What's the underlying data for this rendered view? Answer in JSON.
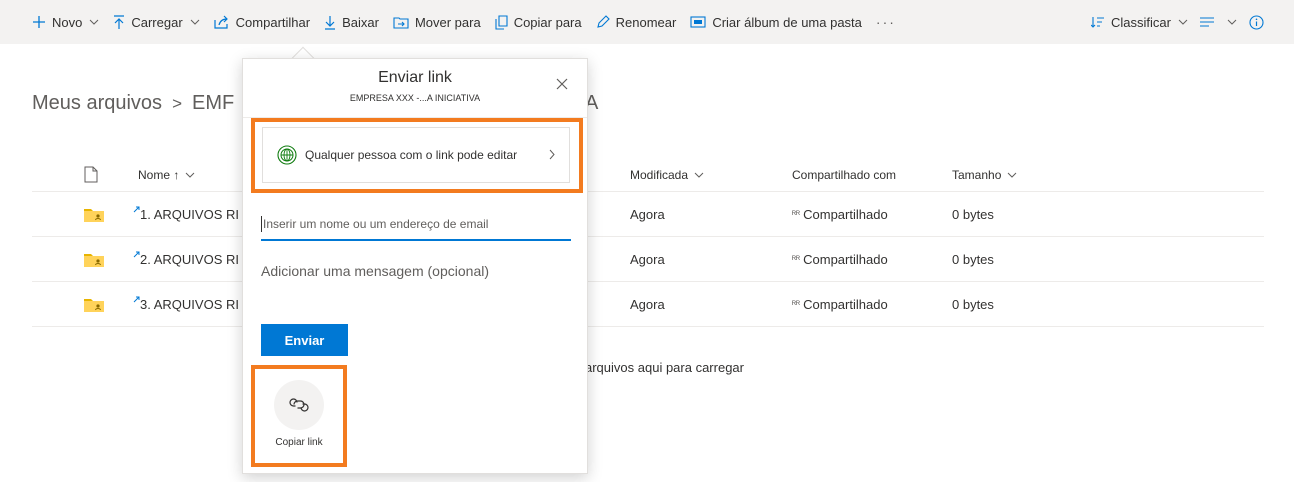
{
  "commandBar": {
    "items": [
      {
        "label": "Novo",
        "icon": "plus-icon",
        "dropdown": true
      },
      {
        "label": "Carregar",
        "icon": "upload-icon",
        "dropdown": true
      },
      {
        "label": "Compartilhar",
        "icon": "share-icon",
        "dropdown": false
      },
      {
        "label": "Baixar",
        "icon": "download-icon",
        "dropdown": false
      },
      {
        "label": "Mover para",
        "icon": "move-icon",
        "dropdown": false
      },
      {
        "label": "Copiar para",
        "icon": "copy-icon",
        "dropdown": false
      },
      {
        "label": "Renomear",
        "icon": "pencil-icon",
        "dropdown": false
      },
      {
        "label": "Criar álbum de uma pasta",
        "icon": "album-icon",
        "dropdown": false
      }
    ],
    "more": "···",
    "sort_label": "Classificar",
    "accent_color": "#0078d4"
  },
  "breadcrumb": {
    "root": "Meus arquivos",
    "separator": ">",
    "current": "EMF",
    "tail": "A"
  },
  "fileList": {
    "columns": {
      "name": "Nome ↑",
      "modified": "Modificada",
      "shared": "Compartilhado com",
      "size": "Tamanho"
    },
    "rows": [
      {
        "name": "1. ARQUIVOS RI",
        "modified": "Agora",
        "shared": "Compartilhado",
        "size": "0 bytes"
      },
      {
        "name": "2. ARQUIVOS RI",
        "modified": "Agora",
        "shared": "Compartilhado",
        "size": "0 bytes"
      },
      {
        "name": "3. ARQUIVOS RI",
        "modified": "Agora",
        "shared": "Compartilhado",
        "size": "0 bytes"
      }
    ],
    "drop_hint": "arquivos aqui para carregar"
  },
  "sharePanel": {
    "title": "Enviar link",
    "subtitle": "EMPRESA XXX -...A INICIATIVA",
    "link_setting": "Qualquer pessoa com o link pode editar",
    "email_placeholder": "Inserir um nome ou um endereço de email",
    "message_placeholder": "Adicionar uma mensagem (opcional)",
    "send_label": "Enviar",
    "copy_link_label": "Copiar link",
    "highlight_color": "#f37b1f"
  }
}
